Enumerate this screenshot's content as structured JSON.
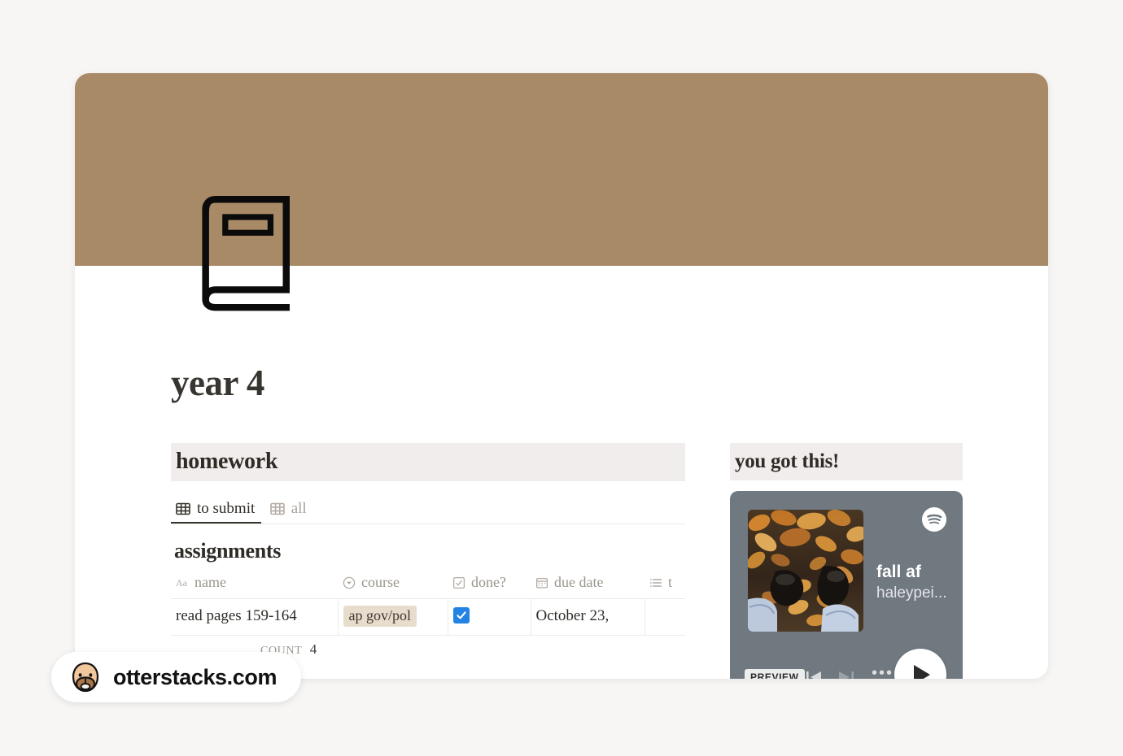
{
  "page": {
    "title": "year 4",
    "icon": "book-icon",
    "cover_color": "#a98a66",
    "background_color": "#f7f6f4"
  },
  "left_column": {
    "heading": "homework",
    "tabs": [
      {
        "label": "to submit",
        "icon": "table-view-icon",
        "active": true
      },
      {
        "label": "all",
        "icon": "table-view-icon",
        "active": false
      }
    ],
    "database": {
      "title": "assignments",
      "columns": [
        {
          "label": "name",
          "icon": "text-type-icon"
        },
        {
          "label": "course",
          "icon": "select-type-icon"
        },
        {
          "label": "done?",
          "icon": "checkbox-type-icon"
        },
        {
          "label": "due date",
          "icon": "calendar-type-icon"
        },
        {
          "label": "t",
          "icon": "multiselect-type-icon"
        }
      ],
      "rows": [
        {
          "name": "read pages 159-164",
          "course": "ap gov/pol",
          "done": true,
          "due_date": "October 23,",
          "tags": ""
        }
      ],
      "footer": {
        "label": "COUNT",
        "value": "4"
      }
    }
  },
  "right_column": {
    "heading": "you got this!",
    "spotify": {
      "provider": "spotify",
      "track_title": "fall af",
      "artist": "haleypei...",
      "preview_label": "PREVIEW",
      "player_color": "#707880",
      "controls": [
        "previous-track",
        "next-track",
        "more-options",
        "play"
      ]
    }
  },
  "watermark": {
    "label": "otterstacks.com",
    "logo": "otter-face-icon"
  },
  "colors": {
    "accent_brown": "#a98a66",
    "band": "#f1edec",
    "tag_bg": "#e8dccd",
    "checkbox_blue": "#2383e2",
    "text": "#2f2c27",
    "muted_text": "#9b968e"
  }
}
